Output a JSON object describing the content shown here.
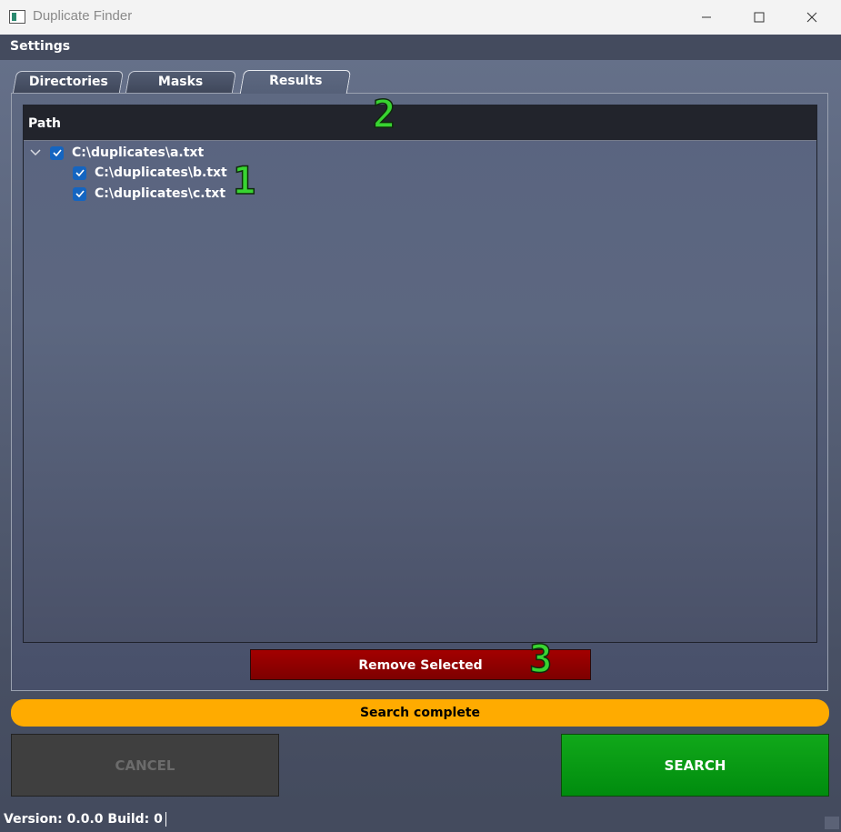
{
  "window": {
    "title": "Duplicate Finder",
    "controls": [
      "minimize-icon",
      "maximize-icon",
      "close-icon"
    ]
  },
  "menu": {
    "settings": "Settings"
  },
  "tabs": [
    {
      "label": "Directories",
      "active": false
    },
    {
      "label": "Masks",
      "active": false
    },
    {
      "label": "Results",
      "active": true
    }
  ],
  "results": {
    "column_header": "Path",
    "rows": [
      {
        "label": "C:\\duplicates\\a.txt",
        "checked": true,
        "expanded": true,
        "level": 0
      },
      {
        "label": "C:\\duplicates\\b.txt",
        "checked": true,
        "level": 1
      },
      {
        "label": "C:\\duplicates\\c.txt",
        "checked": true,
        "level": 1
      }
    ],
    "remove_button": "Remove Selected"
  },
  "annotations": [
    "1",
    "2",
    "3"
  ],
  "status": {
    "text": "Search complete",
    "color": "#ffab00"
  },
  "actions": {
    "cancel": "CANCEL",
    "search": "SEARCH",
    "search_color": "#11a81a",
    "remove_color": "#a30000"
  },
  "footer": {
    "version": "Version: 0.0.0 Build: 0"
  }
}
